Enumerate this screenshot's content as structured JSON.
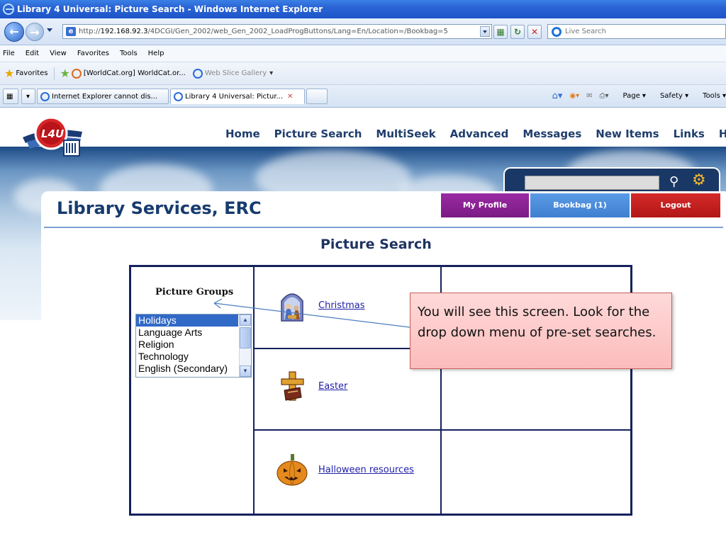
{
  "window": {
    "title": "Library 4 Universal: Picture Search - Windows Internet Explorer"
  },
  "address_bar": {
    "url_prefix": "http://",
    "url_host": "192.168.92.3",
    "url_path": "/4DCGI/Gen_2002/web_Gen_2002_LoadProgButtons/Lang=En/Location=/Bookbag=5",
    "search_placeholder": "Live Search"
  },
  "menu": [
    "File",
    "Edit",
    "View",
    "Favorites",
    "Tools",
    "Help"
  ],
  "favorites_bar": {
    "favorites_label": "Favorites",
    "items": [
      "[WorldCat.org] WorldCat.or...",
      "Web Slice Gallery"
    ]
  },
  "tabs": [
    {
      "label": "Internet Explorer cannot dis..."
    },
    {
      "label": "Library 4 Universal: Pictur...",
      "active": true
    }
  ],
  "tab_tools": {
    "page": "Page",
    "safety": "Safety",
    "tools": "Tools"
  },
  "site": {
    "logo_text": "L4U",
    "nav": [
      "Home",
      "Picture Search",
      "MultiSeek",
      "Advanced",
      "Messages",
      "New Items",
      "Links",
      "Hel"
    ],
    "library_title": "Library Services, ERC",
    "buttons": {
      "profile": "My Profile",
      "bookbag": "Bookbag (1)",
      "logout": "Logout"
    },
    "page_heading": "Picture Search"
  },
  "picture_groups": {
    "label": "Picture Groups",
    "options": [
      "Holidays",
      "Language Arts",
      "Religion",
      "Technology",
      "English (Secondary)"
    ],
    "selected": "Holidays"
  },
  "pictures": [
    {
      "label": "Christmas",
      "icon": "nativity-icon"
    },
    {
      "label": "Easter",
      "icon": "cross-icon"
    },
    {
      "label": "Halloween resources",
      "icon": "pumpkin-icon"
    }
  ],
  "callout": {
    "text": "You will see this screen.  Look for the drop down menu of pre-set searches."
  },
  "colors": {
    "profile": "#8a229a",
    "bookbag": "#4a8ddc",
    "logout": "#c41f1f",
    "grid_border": "#14215c",
    "heading": "#163b6e"
  }
}
